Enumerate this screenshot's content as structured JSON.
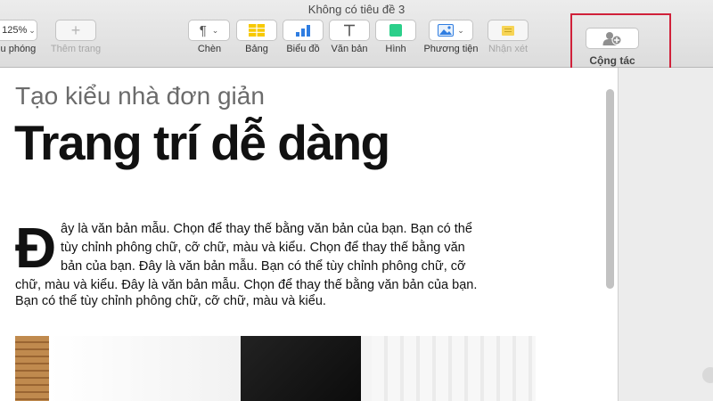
{
  "window": {
    "title": "Không có tiêu đề 3"
  },
  "toolbar": {
    "zoom_value": "125%",
    "zoom_label": "Thu phóng",
    "add_page_label": "Thêm trang",
    "insert_label": "Chèn",
    "table_label": "Bảng",
    "chart_label": "Biểu đồ",
    "text_label": "Văn bản",
    "shape_label": "Hình",
    "media_label": "Phương tiện",
    "comment_label": "Nhận xét",
    "collaborate_label": "Cộng tác"
  },
  "document": {
    "subtitle": "Tạo kiểu nhà đơn giản",
    "title": "Trang trí dễ dàng",
    "drop_cap": "Đ",
    "body_lines": [
      "ây là văn bản mẫu. Chọn để thay thế bằng văn bản của bạn. Bạn có thể",
      "tùy chỉnh phông chữ, cỡ chữ, màu và kiểu. Chọn để thay thế bằng văn",
      "bản của bạn. Đây là văn bản mẫu. Bạn có thể tùy chỉnh phông chữ, cỡ",
      "chữ, màu và kiểu. Đây là văn bản mẫu. Chọn để thay thế bằng văn bản của bạn.",
      "Bạn có thể tùy chỉnh phông chữ, cỡ chữ, màu và kiểu."
    ]
  },
  "colors": {
    "highlight": "#d0213a",
    "table": "#f7c900",
    "chart": "#2f7de1",
    "shape": "#2bcf8a",
    "comment": "#f7d455"
  }
}
